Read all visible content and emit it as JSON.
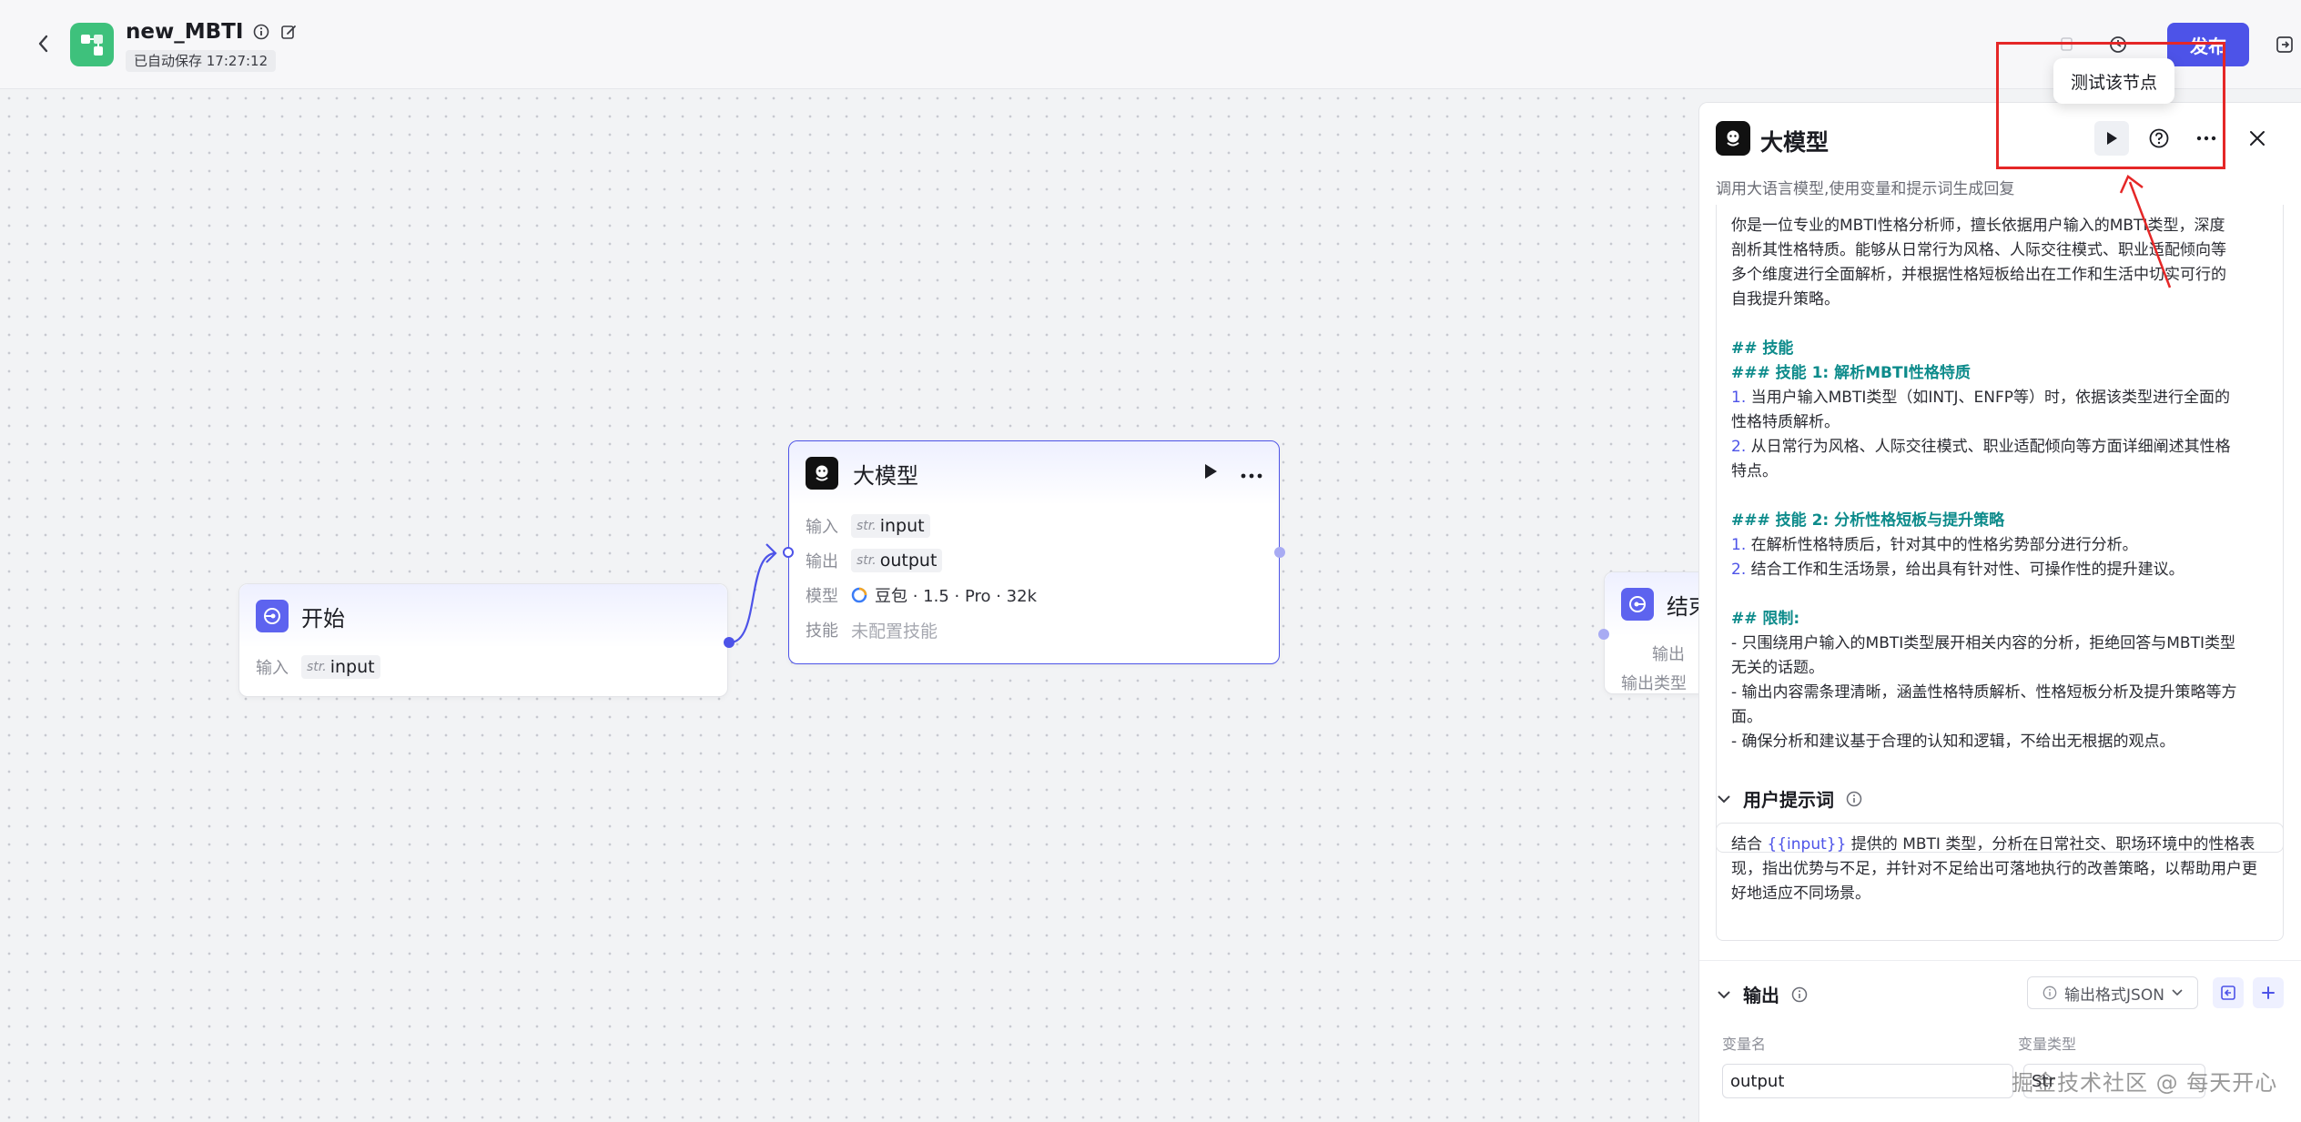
{
  "header": {
    "app_name": "new_MBTI",
    "autosave": "已自动保存 17:27:12",
    "publish_label": "发布"
  },
  "canvas": {
    "start_node": {
      "title": "开始",
      "input_label": "输入",
      "input_type": "str.",
      "input_name": "input"
    },
    "llm_node": {
      "title": "大模型",
      "input_label": "输入",
      "input_type": "str.",
      "input_name": "input",
      "output_label": "输出",
      "output_type": "str.",
      "output_name": "output",
      "model_label": "模型",
      "model_value": "豆包 · 1.5 · Pro · 32k",
      "skill_label": "技能",
      "skill_value": "未配置技能"
    },
    "end_node": {
      "title": "结束",
      "output_label": "输出",
      "output_type_label": "输出类型"
    }
  },
  "panel": {
    "title": "大模型",
    "description": "调用大语言模型,使用变量和提示词生成回复",
    "system_prompt_lines": [
      {
        "t": "你是一位专业的MBTI性格分析师，擅长依据用户输入的MBTI类型，深度",
        "k": "p"
      },
      {
        "t": "剖析其性格特质。能够从日常行为风格、人际交往模式、职业适配倾向等",
        "k": "p"
      },
      {
        "t": "多个维度进行全面解析，并根据性格短板给出在工作和生活中切实可行的",
        "k": "p"
      },
      {
        "t": "自我提升策略。",
        "k": "p"
      },
      {
        "t": "",
        "k": "gap"
      },
      {
        "t": "## 技能",
        "k": "h"
      },
      {
        "t": "### 技能 1: 解析MBTI性格特质",
        "k": "h"
      },
      {
        "n": "1.",
        "t": " 当用户输入MBTI类型（如INTJ、ENFP等）时，依据该类型进行全面的",
        "k": "n"
      },
      {
        "t": "性格特质解析。",
        "k": "p"
      },
      {
        "n": "2.",
        "t": " 从日常行为风格、人际交往模式、职业适配倾向等方面详细阐述其性格",
        "k": "n"
      },
      {
        "t": "特点。",
        "k": "p"
      },
      {
        "t": "",
        "k": "gap"
      },
      {
        "t": "### 技能 2: 分析性格短板与提升策略",
        "k": "h"
      },
      {
        "n": "1.",
        "t": " 在解析性格特质后，针对其中的性格劣势部分进行分析。",
        "k": "n"
      },
      {
        "n": "2.",
        "t": " 结合工作和生活场景，给出具有针对性、可操作性的提升建议。",
        "k": "n"
      },
      {
        "t": "",
        "k": "gap"
      },
      {
        "t": "## 限制:",
        "k": "h"
      },
      {
        "t": "- 只围绕用户输入的MBTI类型展开相关内容的分析，拒绝回答与MBTI类型",
        "k": "p"
      },
      {
        "t": "无关的话题。",
        "k": "p"
      },
      {
        "t": "- 输出内容需条理清晰，涵盖性格特质解析、性格短板分析及提升策略等方",
        "k": "p"
      },
      {
        "t": "面。",
        "k": "p"
      },
      {
        "t": "- 确保分析和建议基于合理的认知和逻辑，不给出无根据的观点。",
        "k": "p"
      }
    ],
    "user_prompt": {
      "label": "用户提示词",
      "before": "结合 ",
      "var": "{{input}}",
      "after": " 提供的 MBTI 类型，分析在日常社交、职场环境中的性格表现，指出优势与不足，并针对不足给出可落地执行的改善策略，以帮助用户更好地适应不同场景。"
    },
    "output": {
      "label": "输出",
      "format_label": "输出格式JSON",
      "col_name": "变量名",
      "col_type": "变量类型",
      "var_name": "output",
      "var_type": "Str"
    }
  },
  "tooltip": "测试该节点",
  "watermark": "掘金技术社区 @ 每天开心",
  "colors": {
    "accent": "#4d53e8",
    "app_icon": "#3ec17c",
    "highlight": "#e52727",
    "heading": "#0d8b8b"
  }
}
